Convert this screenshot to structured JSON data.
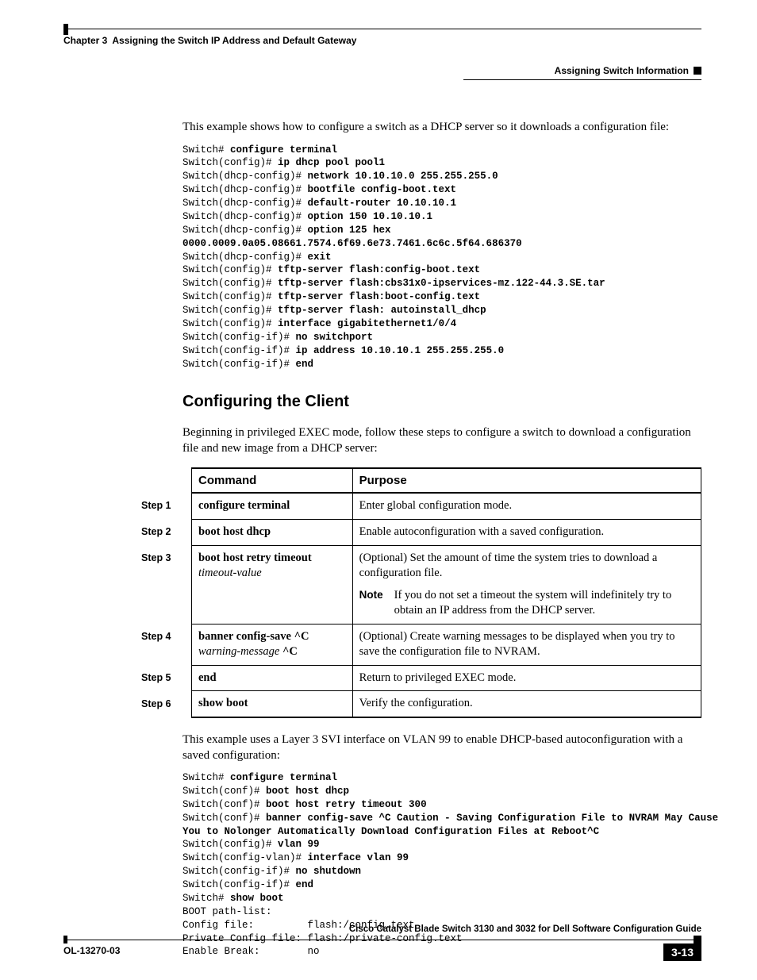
{
  "header": {
    "chapter_label": "Chapter 3",
    "chapter_title": "Assigning the Switch IP Address and Default Gateway",
    "section_title_right": "Assigning Switch Information"
  },
  "intro1": "This example shows how to configure a switch as a DHCP server so it downloads a configuration file:",
  "code1": {
    "l1p": "Switch# ",
    "l1b": "configure terminal",
    "l2p": "Switch(config)# ",
    "l2b": "ip dhcp pool pool1",
    "l3p": "Switch(dhcp-config)# ",
    "l3b": "network 10.10.10.0 255.255.255.0",
    "l4p": "Switch(dhcp-config)# ",
    "l4b": "bootfile config-boot.text",
    "l5p": "Switch(dhcp-config)# ",
    "l5b": "default-router 10.10.10.1",
    "l6p": "Switch(dhcp-config)# ",
    "l6b": "option 150 10.10.10.1",
    "l7p": "Switch(dhcp-config)# ",
    "l7b": "option 125 hex",
    "l8b": "0000.0009.0a05.08661.7574.6f69.6e73.7461.6c6c.5f64.686370",
    "l9p": "Switch(dhcp-config)# ",
    "l9b": "exit",
    "l10p": "Switch(config)# ",
    "l10b": "tftp-server flash:config-boot.text",
    "l11p": "Switch(config)# ",
    "l11b": "tftp-server flash:cbs31x0-ipservices-mz.122-44.3.SE.tar",
    "l12p": "Switch(config)# ",
    "l12b": "tftp-server flash:boot-config.text",
    "l13p": "Switch(config)# ",
    "l13b": "tftp-server flash: autoinstall_dhcp",
    "l14p": "Switch(config)# ",
    "l14b": "interface gigabitethernet1/0/4",
    "l15p": "Switch(config-if)# ",
    "l15b": "no switchport",
    "l16p": "Switch(config-if)# ",
    "l16b": "ip address 10.10.10.1 255.255.255.0",
    "l17p": "Switch(config-if)# ",
    "l17b": "end"
  },
  "section_heading": "Configuring the Client",
  "intro2": "Beginning in privileged EXEC mode, follow these steps to configure a switch to download a configuration file and new image from a DHCP server:",
  "table": {
    "headers": {
      "command": "Command",
      "purpose": "Purpose"
    },
    "steps": [
      {
        "step": "Step 1",
        "cmd_bold": "configure terminal",
        "cmd_ital": "",
        "cmd_tail": "",
        "purpose": "Enter global configuration mode."
      },
      {
        "step": "Step 2",
        "cmd_bold": "boot host dhcp",
        "cmd_ital": "",
        "cmd_tail": "",
        "purpose": "Enable autoconfiguration with a saved configuration."
      },
      {
        "step": "Step 3",
        "cmd_bold": "boot host retry timeout ",
        "cmd_ital": "timeout-value",
        "cmd_tail": "",
        "purpose": "(Optional) Set the amount of time the system tries to download a configuration file.",
        "note_label": "Note",
        "note_text": "If you do not set a timeout the system will indefinitely try to obtain an IP address from the DHCP server."
      },
      {
        "step": "Step 4",
        "cmd_bold": "banner config-save ^C ",
        "cmd_ital": "warning-message ",
        "cmd_tail": "^C",
        "purpose": "(Optional) Create warning messages to be displayed when you try to save the configuration file to NVRAM."
      },
      {
        "step": "Step 5",
        "cmd_bold": "end",
        "cmd_ital": "",
        "cmd_tail": "",
        "purpose": "Return to privileged EXEC mode."
      },
      {
        "step": "Step 6",
        "cmd_bold": "show boot",
        "cmd_ital": "",
        "cmd_tail": "",
        "purpose": "Verify the configuration."
      }
    ]
  },
  "intro3": "This example uses a Layer 3 SVI interface on VLAN 99 to enable DHCP-based autoconfiguration with a saved configuration:",
  "code2": {
    "l1p": "Switch# ",
    "l1b": "configure terminal",
    "l2p": "Switch(conf)# ",
    "l2b": "boot host dhcp",
    "l3p": "Switch(conf)# ",
    "l3b": "boot host retry timeout 300",
    "l4p": "Switch(conf)# ",
    "l4b": "banner config-save ^C Caution - Saving Configuration File to NVRAM May Cause",
    "l5b": "You to Nolonger Automatically Download Configuration Files at Reboot^C",
    "l6p": "Switch(config)# ",
    "l6b": "vlan 99",
    "l7p": "Switch(config-vlan)# ",
    "l7b": "interface vlan 99",
    "l8p": "Switch(config-if)# ",
    "l8b": "no shutdown",
    "l9p": "Switch(config-if)# ",
    "l9b": "end",
    "l10p": "Switch# ",
    "l10b": "show boot",
    "l11": "BOOT path-list:",
    "l12": "Config file:         flash:/config.text",
    "l13": "Private Config file: flash:/private-config.text",
    "l14": "Enable Break:        no"
  },
  "footer": {
    "guide_title": "Cisco Catalyst Blade Switch 3130 and 3032 for Dell Software Configuration Guide",
    "doc_id": "OL-13270-03",
    "page_num": "3-13"
  }
}
